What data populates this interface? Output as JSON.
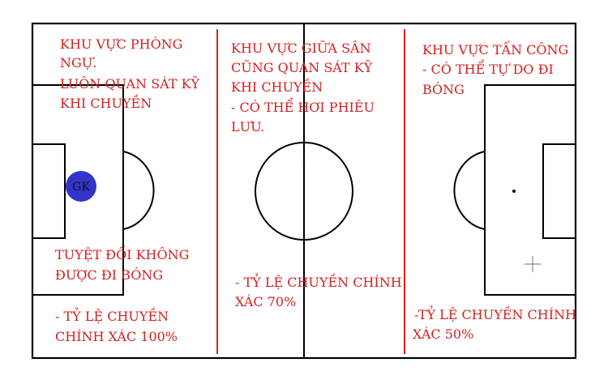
{
  "colors": {
    "pitch_lines": "#000000",
    "zone_dividers": "#e02020",
    "annotation_text": "#d42020",
    "goalkeeper_fill": "#3434c8"
  },
  "zones": {
    "defense": {
      "title_line1": "KHU VỰC PHÒNG",
      "title_line2": "NGỰ.",
      "note_line1": "LUÔN QUAN SÁT KỸ",
      "note_line2": "KHI CHUYỀN",
      "rule_line1": "TUYỆT ĐỐI KHÔNG",
      "rule_line2": "ĐƯỢC ĐI BÓNG",
      "pass_line1": "- TỶ LỆ CHUYỀN",
      "pass_line2": "CHÍNH XÁC 100%"
    },
    "midfield": {
      "title_line1": "KHU VỰC GIỮA SÂN",
      "note_line1": "CŨNG QUAN SÁT KỸ",
      "note_line2": "KHI CHUYỀN",
      "note_line3": "- CÓ THỂ HƠI PHIÊU",
      "note_line4": "LƯU.",
      "pass_line1": "- TỶ LỆ CHUYỀN CHÍNH",
      "pass_line2": "XÁC 70%"
    },
    "attack": {
      "title_line1": "KHU VỰC TẤN CÔNG",
      "note_line1": "- CÓ THỂ TỰ DO ĐI",
      "note_line2": "BÓNG",
      "pass_line1": "-TỶ LỆ CHUYỀN CHÍNH",
      "pass_line2": "XÁC 50%"
    }
  },
  "goalkeeper": {
    "label": "GK"
  }
}
